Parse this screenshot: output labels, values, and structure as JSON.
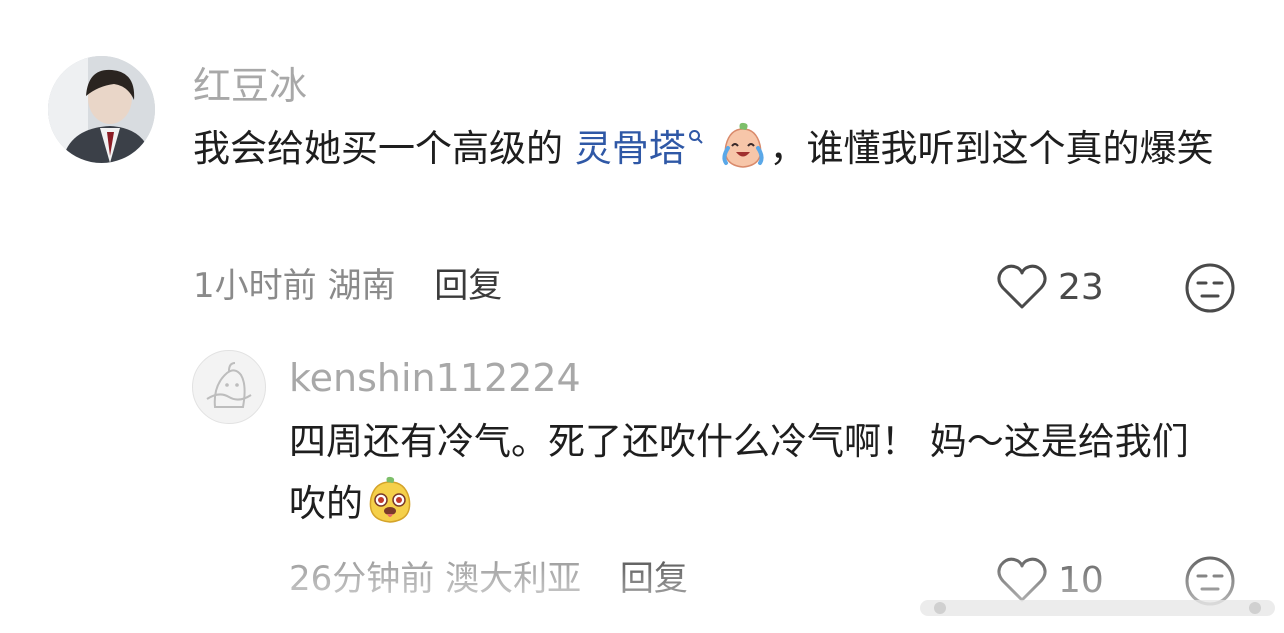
{
  "comments": [
    {
      "username": "红豆冰",
      "text_before": "我会给她买一个高级的 ",
      "link_text": "灵骨塔",
      "text_after": "，谁懂我听到这个真的爆笑",
      "time": "1小时前",
      "location": "湖南",
      "reply_label": "回复",
      "likes": "23",
      "emoji": "crying-laugh-emoji"
    },
    {
      "username": "kenshin112224",
      "text_before": "四周还有冷气。死了还吹什么冷气啊！ 妈～这是给我们吹的",
      "time": "26分钟前",
      "location": "澳大利亚",
      "reply_label": "回复",
      "likes": "10",
      "emoji": "dog-face-emoji"
    }
  ],
  "colors": {
    "username": "#a8a8a8",
    "link": "#2f58a6",
    "meta": "#8a8a8a",
    "body": "#1e1e1e"
  }
}
